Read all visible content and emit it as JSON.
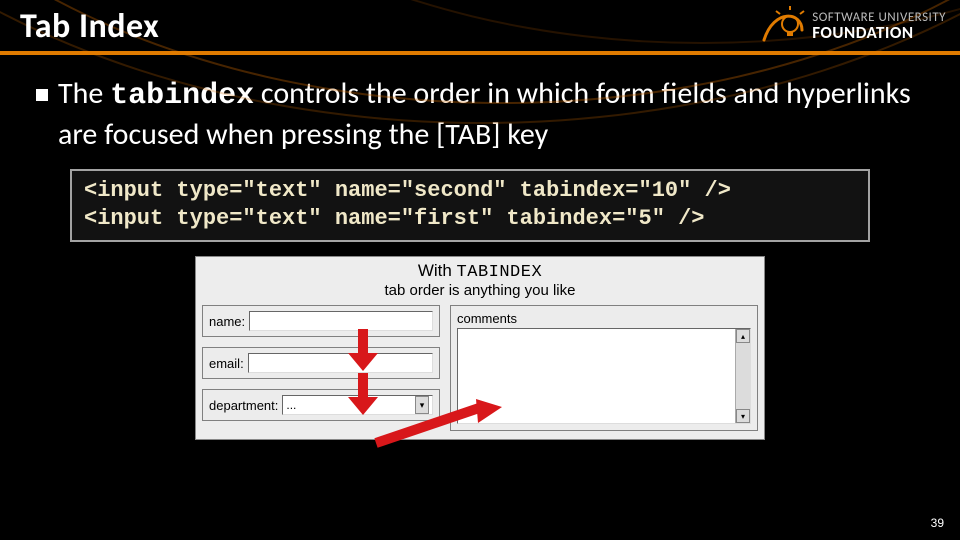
{
  "header": {
    "title": "Tab Index",
    "logo_line1": "SOFTWARE UNIVERSITY",
    "logo_line2": "FOUNDATION"
  },
  "bullet": {
    "pre": "The ",
    "code": "tabindex",
    "mid": " controls the order in which form fields and hyperlinks are focused when pressing the ",
    "key": "[TAB]",
    "post": " key"
  },
  "code": {
    "line1": "<input type=\"text\" name=\"second\" tabindex=\"10\" />",
    "line2": "<input type=\"text\" name=\"first\" tabindex=\"5\" />"
  },
  "figure": {
    "title_pre": "With ",
    "title_code": "TABINDEX",
    "subtitle": "tab order is anything you like",
    "left_rows": [
      {
        "label": "name:"
      },
      {
        "label": "email:"
      },
      {
        "label": "department:",
        "value": "..."
      }
    ],
    "right_label": "comments",
    "scroll_up": "▴",
    "scroll_down": "▾",
    "dropdown_glyph": "▾"
  },
  "page_number": "39"
}
